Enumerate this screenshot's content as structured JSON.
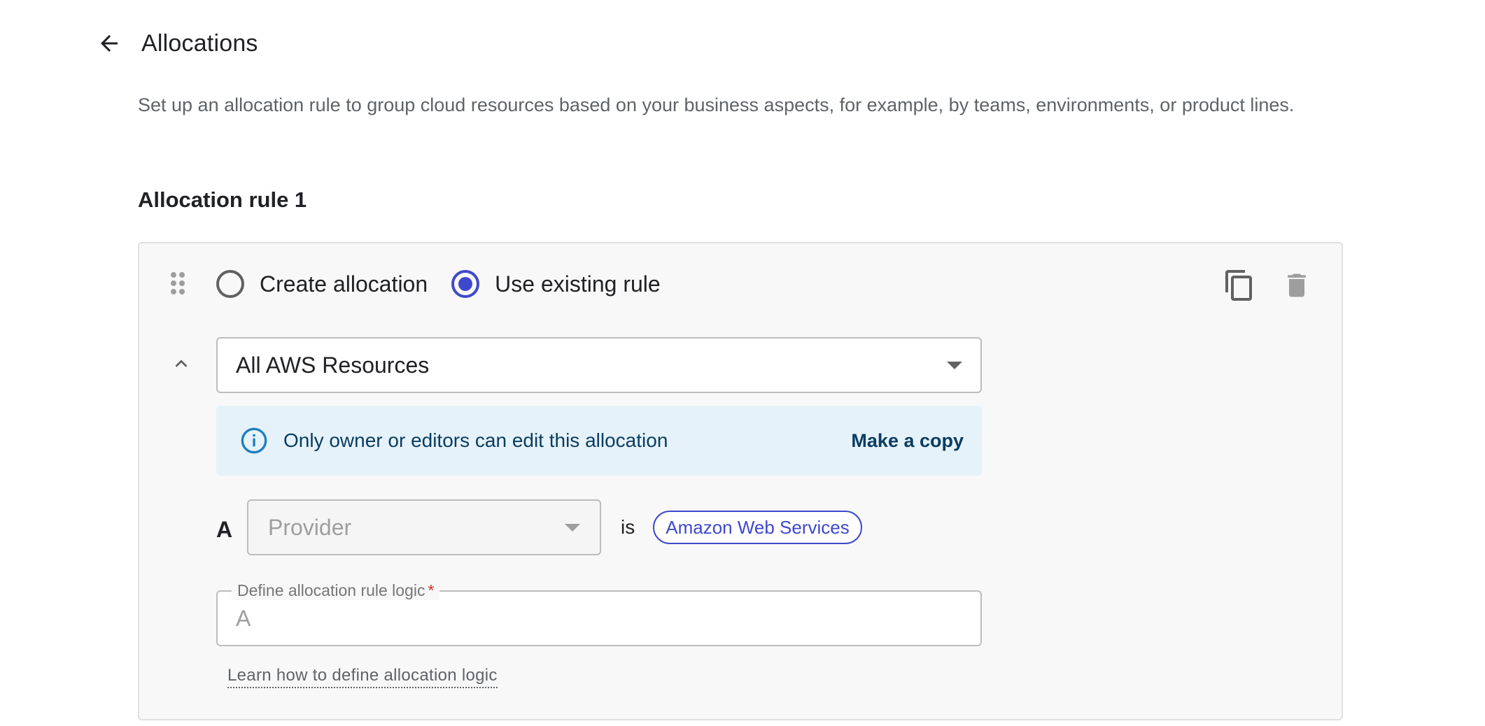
{
  "header": {
    "title": "Allocations"
  },
  "description": "Set up an allocation rule to group cloud resources based on your business aspects, for example, by teams, environments, or product lines.",
  "rule": {
    "title": "Allocation rule 1",
    "mode_options": [
      {
        "label": "Create allocation",
        "checked": false
      },
      {
        "label": "Use existing rule",
        "checked": true
      }
    ],
    "selected_rule": "All AWS Resources",
    "info_banner": {
      "text": "Only owner or editors can edit this allocation",
      "action": "Make a copy"
    },
    "condition": {
      "letter": "A",
      "field_placeholder": "Provider",
      "operator": "is",
      "value_chip": "Amazon Web Services"
    },
    "logic": {
      "label": "Define allocation rule logic",
      "required_mark": "*",
      "placeholder": "A",
      "value": ""
    },
    "learn_link": "Learn how to define allocation logic"
  },
  "icons": {
    "back": "arrow-back-icon",
    "drag": "drag-handle-icon",
    "copy": "copy-icon",
    "delete": "delete-icon",
    "collapse": "chevron-up-icon",
    "info": "info-icon",
    "dropdown": "caret-down-icon"
  },
  "colors": {
    "accent": "#3f48cc",
    "info_bg": "#e6f2f9",
    "info_text": "#0a3d62",
    "required": "#d32f2f"
  }
}
